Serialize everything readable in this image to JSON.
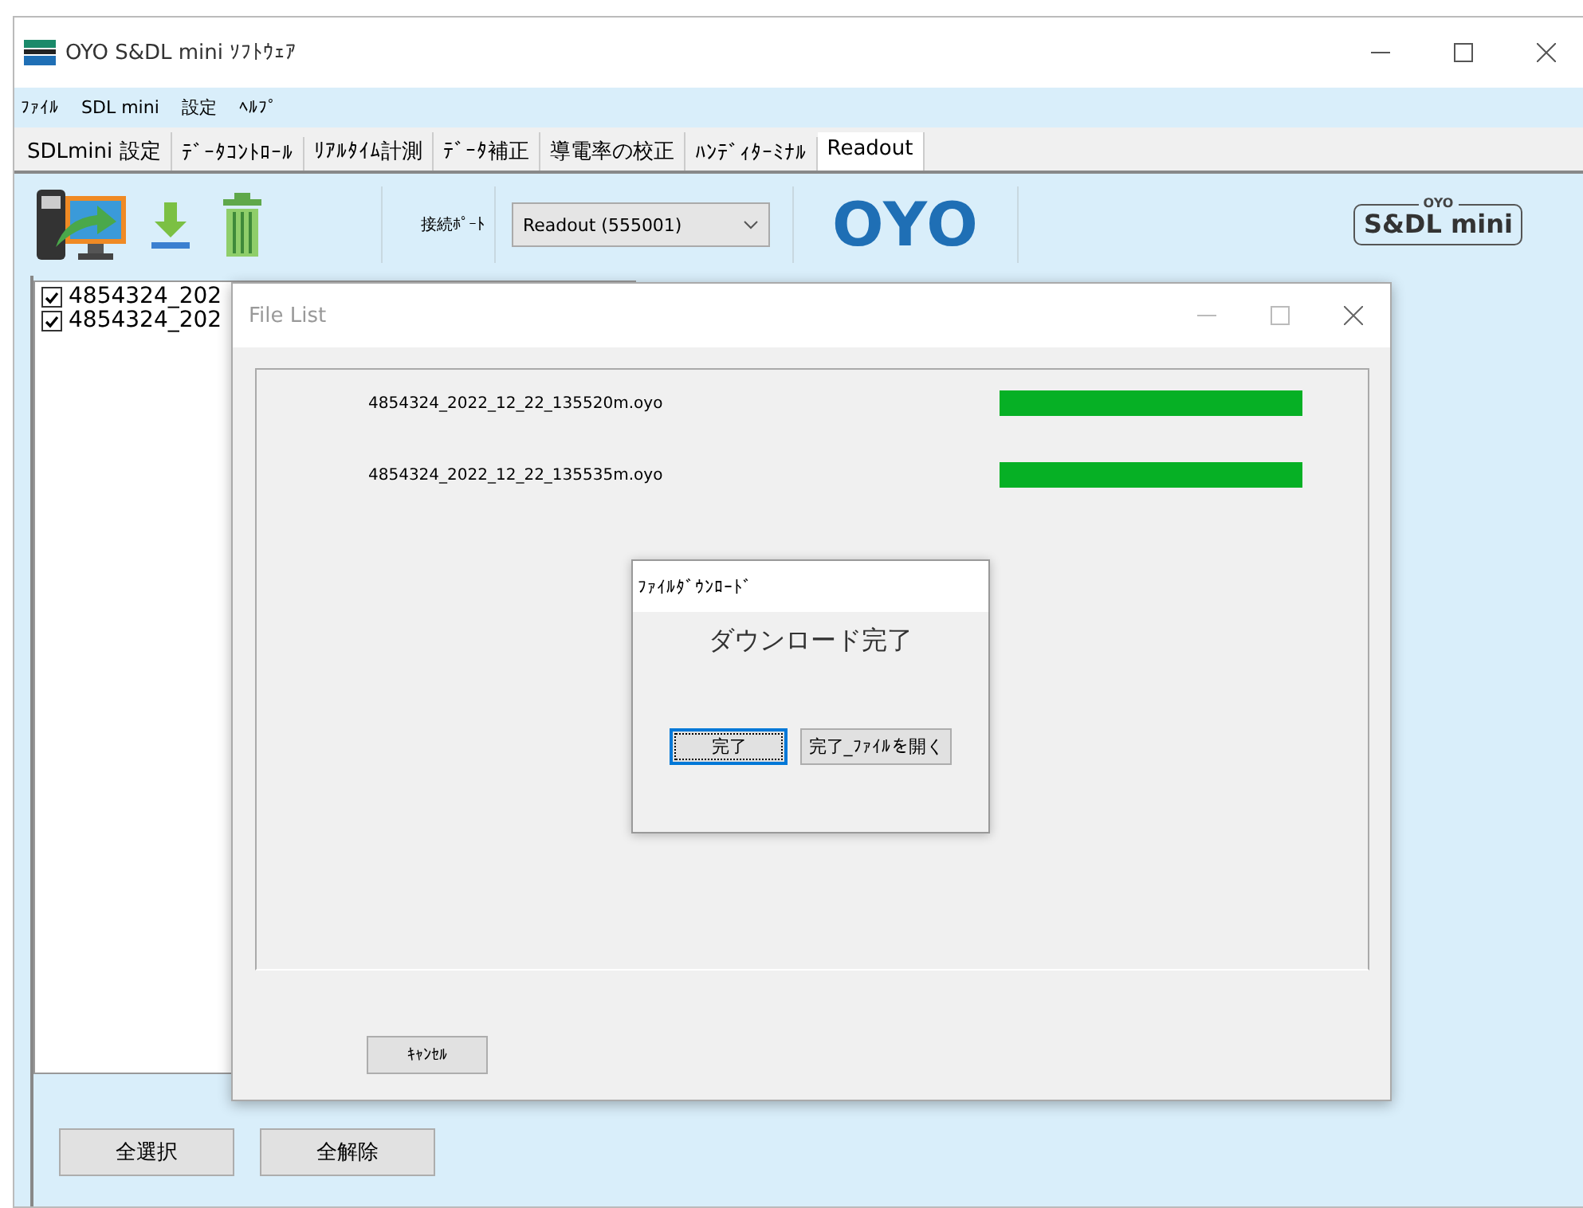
{
  "window": {
    "title": "OYO S&DL mini ｿﾌﾄｳｪｱ"
  },
  "menu": [
    "ﾌｧｲﾙ",
    "SDL mini",
    "設定",
    "ﾍﾙﾌﾟ"
  ],
  "tabs": [
    {
      "label": "SDLmini 設定",
      "selected": false
    },
    {
      "label": "ﾃﾞｰﾀｺﾝﾄﾛｰﾙ",
      "selected": false
    },
    {
      "label": "ﾘｱﾙﾀｲﾑ計測",
      "selected": false
    },
    {
      "label": "ﾃﾞｰﾀ補正",
      "selected": false
    },
    {
      "label": "導電率の校正",
      "selected": false
    },
    {
      "label": "ﾊﾝﾃﾞｨﾀｰﾐﾅﾙ",
      "selected": false
    },
    {
      "label": "Readout",
      "selected": true
    }
  ],
  "toolbar": {
    "port_label": "接続ﾎﾟｰﾄ",
    "port_value": "Readout (555001)",
    "logo": "OYO",
    "product_logo": {
      "brand": "OYO",
      "name": "S&DL mini"
    }
  },
  "files": [
    {
      "name": "4854324_202",
      "checked": true
    },
    {
      "name": "4854324_202",
      "checked": true
    }
  ],
  "buttons": [
    "全選択",
    "全解除"
  ],
  "file_list_dialog": {
    "title": "File List",
    "files": [
      {
        "name": "4854324_2022_12_22_135520m.oyo",
        "level": 1
      },
      {
        "name": "4854324_2022_12_22_135535m.oyo",
        "level": 1
      }
    ],
    "cancel": "ｷｬﾝｾﾙ"
  },
  "download_dialog": {
    "title": "ﾌｧｲﾙﾀﾞｳﾝﾛｰﾄﾞ",
    "message": "ダウンロード完了",
    "buttons": [
      {
        "label": "完了",
        "focused": true
      },
      {
        "label": "完了_ﾌｧｲﾙを開く",
        "focused": false
      }
    ]
  }
}
